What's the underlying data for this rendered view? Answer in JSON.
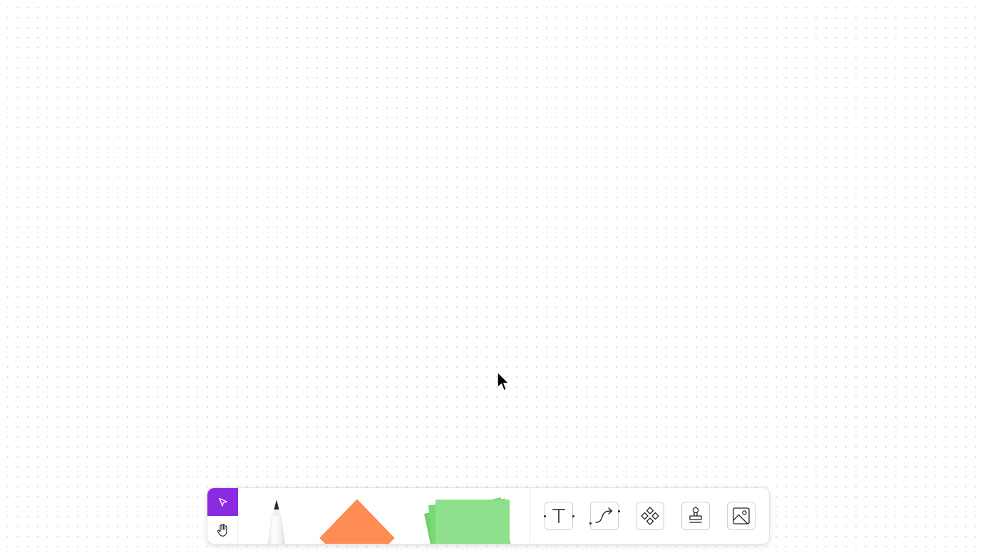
{
  "canvas": {
    "background": "#ffffff",
    "grid_dot_color": "#d8d8d8"
  },
  "toolbar": {
    "mode_buttons": [
      {
        "name": "select",
        "icon": "cursor-arrow-icon",
        "active": true
      },
      {
        "name": "hand",
        "icon": "hand-pan-icon",
        "active": false
      }
    ],
    "accent_color": "#8a2be2",
    "drawer_tools": [
      {
        "name": "pen",
        "icon": "pen-icon"
      },
      {
        "name": "shape",
        "icon": "diamond-shape-icon",
        "color": "#ff8c52"
      },
      {
        "name": "sticky-note",
        "icon": "sticky-note-icon",
        "color": "#8ee08c"
      }
    ],
    "tools": [
      {
        "name": "text",
        "icon": "text-icon"
      },
      {
        "name": "connector",
        "icon": "connector-arrow-icon"
      },
      {
        "name": "components",
        "icon": "components-icon"
      },
      {
        "name": "stamp",
        "icon": "stamp-icon"
      },
      {
        "name": "image",
        "icon": "image-icon"
      }
    ]
  }
}
